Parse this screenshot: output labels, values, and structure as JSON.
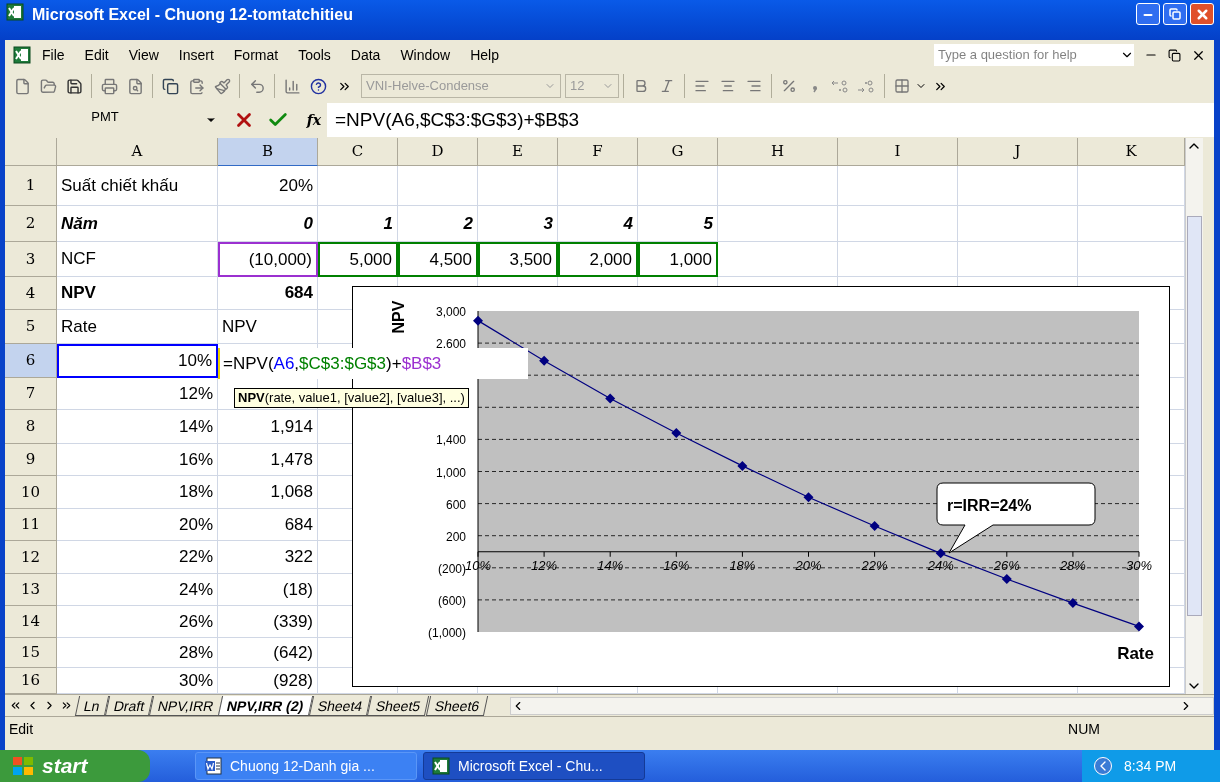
{
  "window": {
    "title": "Microsoft Excel - Chuong 12-tomtatchitieu"
  },
  "menu": [
    {
      "label": "File"
    },
    {
      "label": "Edit"
    },
    {
      "label": "View"
    },
    {
      "label": "Insert"
    },
    {
      "label": "Format"
    },
    {
      "label": "Tools"
    },
    {
      "label": "Data"
    },
    {
      "label": "Window"
    },
    {
      "label": "Help"
    }
  ],
  "help_box": {
    "placeholder": "Type a question for help"
  },
  "toolbar": {
    "font": "VNI-Helve-Condense",
    "size": "12"
  },
  "formula_bar": {
    "name_box": "PMT",
    "fx_label": "fx",
    "formula": "=NPV(A6,$C$3:$G$3)+$B$3"
  },
  "sheet": {
    "columns": [
      {
        "label": "A",
        "selected": false
      },
      {
        "label": "B",
        "selected": true
      },
      {
        "label": "C",
        "selected": false
      },
      {
        "label": "D",
        "selected": false
      },
      {
        "label": "E",
        "selected": false
      },
      {
        "label": "F",
        "selected": false
      },
      {
        "label": "G",
        "selected": false
      },
      {
        "label": "H",
        "selected": false
      },
      {
        "label": "I",
        "selected": false
      },
      {
        "label": "J",
        "selected": false
      },
      {
        "label": "K",
        "selected": false
      }
    ],
    "rows": [
      {
        "number": "1",
        "selected": false,
        "kind": "plain",
        "cells": [
          {
            "text": "Suất chiết khấu",
            "kind": "text"
          },
          {
            "text": "20%",
            "kind": "number"
          }
        ]
      },
      {
        "number": "2",
        "selected": false,
        "kind": "heading",
        "cells": [
          {
            "text": "Năm",
            "kind": "text"
          },
          {
            "text": "0",
            "kind": "number"
          },
          {
            "text": "1",
            "kind": "number"
          },
          {
            "text": "2",
            "kind": "number"
          },
          {
            "text": "3",
            "kind": "number"
          },
          {
            "text": "4",
            "kind": "number"
          },
          {
            "text": "5",
            "kind": "number"
          }
        ]
      },
      {
        "number": "3",
        "selected": false,
        "kind": "plain",
        "cells": [
          {
            "text": "NCF",
            "kind": "text"
          },
          {
            "text": "(10,000)",
            "kind": "number",
            "color": "#9b30d0"
          },
          {
            "text": "5,000",
            "kind": "number",
            "color": "#008000"
          },
          {
            "text": "4,500",
            "kind": "number",
            "color": "#008000"
          },
          {
            "text": "3,500",
            "kind": "number",
            "color": "#008000"
          },
          {
            "text": "2,000",
            "kind": "number",
            "color": "#008000"
          },
          {
            "text": "1,000",
            "kind": "number",
            "color": "#008000"
          }
        ]
      },
      {
        "number": "4",
        "selected": false,
        "kind": "total",
        "cells": [
          {
            "text": "NPV",
            "kind": "text"
          },
          {
            "text": "684",
            "kind": "number"
          }
        ]
      },
      {
        "number": "5",
        "selected": false,
        "kind": "plain",
        "cells": [
          {
            "text": "Rate",
            "kind": "text"
          },
          {
            "text": "NPV",
            "kind": "text"
          }
        ]
      },
      {
        "number": "6",
        "selected": true,
        "kind": "plain",
        "cells": [
          {
            "text": "10%",
            "kind": "number",
            "color": "#0000ff"
          }
        ]
      },
      {
        "number": "7",
        "selected": false,
        "kind": "plain",
        "cells": [
          {
            "text": "12%",
            "kind": "number"
          }
        ]
      },
      {
        "number": "8",
        "selected": false,
        "kind": "plain",
        "cells": [
          {
            "text": "14%",
            "kind": "number"
          },
          {
            "text": "1,914",
            "kind": "number"
          }
        ]
      },
      {
        "number": "9",
        "selected": false,
        "kind": "plain",
        "cells": [
          {
            "text": "16%",
            "kind": "number"
          },
          {
            "text": "1,478",
            "kind": "number"
          }
        ]
      },
      {
        "number": "10",
        "selected": false,
        "kind": "plain",
        "cells": [
          {
            "text": "18%",
            "kind": "number"
          },
          {
            "text": "1,068",
            "kind": "number"
          }
        ]
      },
      {
        "number": "11",
        "selected": false,
        "kind": "plain",
        "cells": [
          {
            "text": "20%",
            "kind": "number"
          },
          {
            "text": "684",
            "kind": "number"
          }
        ]
      },
      {
        "number": "12",
        "selected": false,
        "kind": "plain",
        "cells": [
          {
            "text": "22%",
            "kind": "number"
          },
          {
            "text": "322",
            "kind": "number"
          }
        ]
      },
      {
        "number": "13",
        "selected": false,
        "kind": "plain",
        "cells": [
          {
            "text": "24%",
            "kind": "number"
          },
          {
            "text": "(18)",
            "kind": "number"
          }
        ]
      },
      {
        "number": "14",
        "selected": false,
        "kind": "plain",
        "cells": [
          {
            "text": "26%",
            "kind": "number"
          },
          {
            "text": "(339)",
            "kind": "number"
          }
        ]
      },
      {
        "number": "15",
        "selected": false,
        "kind": "plain",
        "cells": [
          {
            "text": "28%",
            "kind": "number"
          },
          {
            "text": "(642)",
            "kind": "number"
          }
        ]
      },
      {
        "number": "16",
        "selected": false,
        "kind": "plain",
        "cells": [
          {
            "text": "30%",
            "kind": "number"
          },
          {
            "text": "(928)",
            "kind": "number"
          }
        ]
      }
    ]
  },
  "cell_editor": {
    "parts": [
      {
        "text": "=NPV("
      },
      {
        "text": "A6",
        "color": "#0000ff"
      },
      {
        "text": ","
      },
      {
        "text": "$C$3:$G$3",
        "color": "#008000"
      },
      {
        "text": ")+"
      },
      {
        "text": "$B$3",
        "color": "#9b30d0"
      }
    ]
  },
  "tooltip": "**NPV**(rate, value1, [value2], [value3], ...)",
  "chart": {
    "chart_data": {
      "type": "line",
      "xlabel": "Rate",
      "ylabel": "NPV",
      "categories": [
        "10%",
        "12%",
        "14%",
        "16%",
        "18%",
        "20%",
        "22%",
        "24%",
        "26%",
        "28%",
        "30%"
      ],
      "series": [
        {
          "color": "#000080",
          "marker": "diamond",
          "values": [
            2880,
            2380,
            1910,
            1480,
            1070,
            680,
            320,
            -20,
            -340,
            -640,
            -930
          ]
        }
      ],
      "ylim": [
        -1000,
        3000
      ],
      "grid": true,
      "yticks": [
        {
          "value": -1000,
          "label": "(1,000)"
        },
        {
          "value": -600,
          "label": "(600)"
        },
        {
          "value": -200,
          "label": "(200)"
        },
        {
          "value": 200,
          "label": "200"
        },
        {
          "value": 600,
          "label": "600"
        },
        {
          "value": 1000,
          "label": "1,000"
        },
        {
          "value": 1400,
          "label": "1,400"
        },
        {
          "value": 2600,
          "label": "2,600"
        },
        {
          "value": 3000,
          "label": "3,000"
        }
      ],
      "annotations": [
        {
          "text": "r=IRR=24%"
        }
      ]
    }
  },
  "sheet_tabs": [
    {
      "label": "Ln",
      "selected": false
    },
    {
      "label": "Draft",
      "selected": false
    },
    {
      "label": "NPV,IRR",
      "selected": false
    },
    {
      "label": "NPV,IRR (2)",
      "selected": true
    },
    {
      "label": "Sheet4",
      "selected": false
    },
    {
      "label": "Sheet5",
      "selected": false
    },
    {
      "label": "Sheet6",
      "selected": false
    }
  ],
  "status_bar": {
    "mode": "Edit",
    "num": "NUM"
  },
  "taskbar": {
    "start": "start",
    "tasks": [
      {
        "label": "Chuong 12-Danh gia ...",
        "kind": "word",
        "selected": false
      },
      {
        "label": "Microsoft Excel - Chu...",
        "kind": "excel",
        "selected": true
      }
    ],
    "clock": "8:34 PM"
  }
}
